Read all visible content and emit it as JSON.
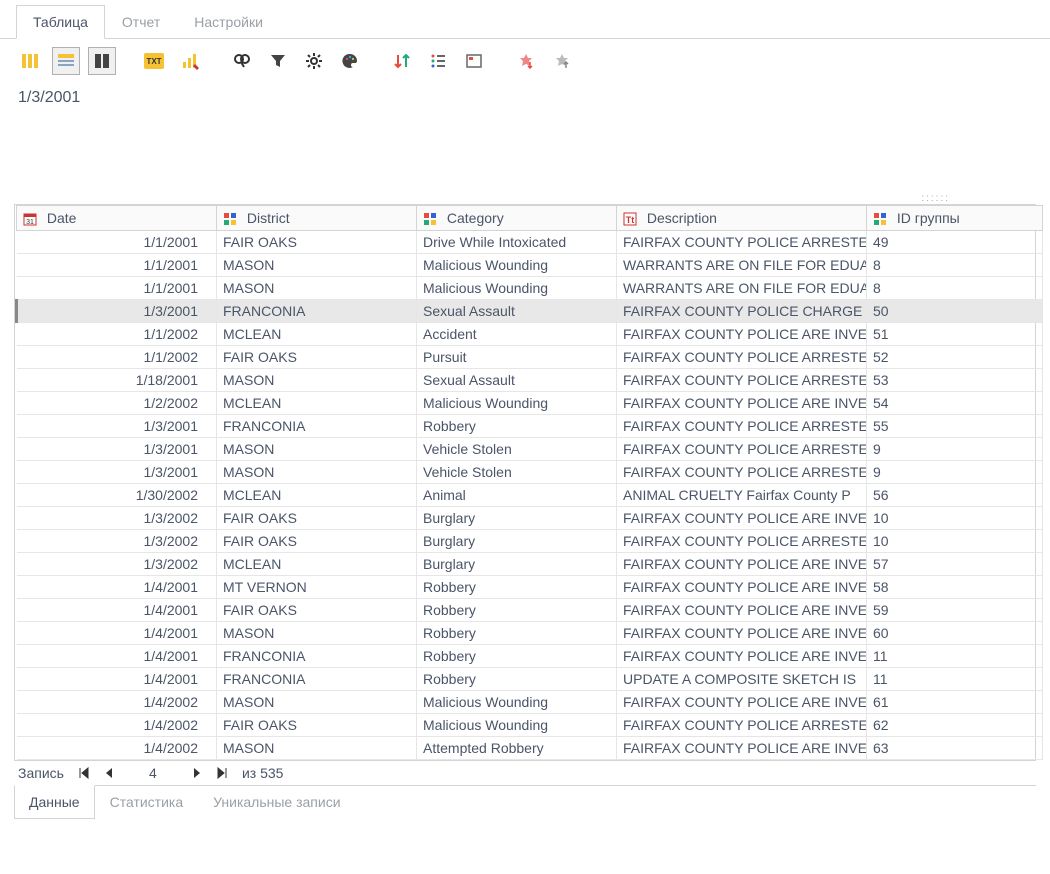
{
  "topTabs": {
    "items": [
      {
        "label": "Таблица",
        "active": true
      },
      {
        "label": "Отчет",
        "active": false
      },
      {
        "label": "Настройки",
        "active": false
      }
    ]
  },
  "detail": {
    "text": "1/3/2001"
  },
  "columns": {
    "date": "Date",
    "district": "District",
    "category": "Category",
    "description": "Description",
    "group": "ID группы"
  },
  "rows": [
    {
      "date": "1/1/2001",
      "district": "FAIR OAKS",
      "category": "Drive While Intoxicated",
      "description": "FAIRFAX COUNTY POLICE ARRESTE",
      "group": "49"
    },
    {
      "date": "1/1/2001",
      "district": "MASON",
      "category": "Malicious Wounding",
      "description": "WARRANTS ARE ON FILE FOR EDUA",
      "group": "8"
    },
    {
      "date": "1/1/2001",
      "district": "MASON",
      "category": "Malicious Wounding",
      "description": "WARRANTS ARE ON FILE FOR EDUA",
      "group": "8"
    },
    {
      "date": "1/3/2001",
      "district": "FRANCONIA",
      "category": "Sexual Assault",
      "description": "FAIRFAX COUNTY POLICE CHARGE",
      "group": "50",
      "selected": true
    },
    {
      "date": "1/1/2002",
      "district": "MCLEAN",
      "category": "Accident",
      "description": "FAIRFAX COUNTY POLICE ARE INVE",
      "group": "51"
    },
    {
      "date": "1/1/2002",
      "district": "FAIR OAKS",
      "category": "Pursuit",
      "description": "FAIRFAX COUNTY POLICE ARRESTE",
      "group": "52"
    },
    {
      "date": "1/18/2001",
      "district": "MASON",
      "category": "Sexual Assault",
      "description": "FAIRFAX COUNTY POLICE ARRESTE",
      "group": "53"
    },
    {
      "date": "1/2/2002",
      "district": "MCLEAN",
      "category": "Malicious Wounding",
      "description": "FAIRFAX COUNTY POLICE ARE INVE",
      "group": "54"
    },
    {
      "date": "1/3/2001",
      "district": "FRANCONIA",
      "category": "Robbery",
      "description": "FAIRFAX COUNTY POLICE ARRESTE",
      "group": "55"
    },
    {
      "date": "1/3/2001",
      "district": "MASON",
      "category": "Vehicle Stolen",
      "description": "FAIRFAX COUNTY POLICE ARRESTE",
      "group": "9"
    },
    {
      "date": "1/3/2001",
      "district": "MASON",
      "category": "Vehicle Stolen",
      "description": "FAIRFAX COUNTY POLICE ARRESTE",
      "group": "9"
    },
    {
      "date": "1/30/2002",
      "district": "MCLEAN",
      "category": "Animal",
      "description": "ANIMAL CRUELTY Fairfax County P",
      "group": "56"
    },
    {
      "date": "1/3/2002",
      "district": "FAIR OAKS",
      "category": "Burglary",
      "description": "FAIRFAX COUNTY POLICE ARE INVE",
      "group": "10"
    },
    {
      "date": "1/3/2002",
      "district": "FAIR OAKS",
      "category": "Burglary",
      "description": "FAIRFAX COUNTY POLICE ARRESTE",
      "group": "10"
    },
    {
      "date": "1/3/2002",
      "district": "MCLEAN",
      "category": "Burglary",
      "description": "FAIRFAX COUNTY POLICE ARE INVE",
      "group": "57"
    },
    {
      "date": "1/4/2001",
      "district": "MT VERNON",
      "category": "Robbery",
      "description": "FAIRFAX COUNTY POLICE ARE INVE",
      "group": "58"
    },
    {
      "date": "1/4/2001",
      "district": "FAIR OAKS",
      "category": "Robbery",
      "description": "FAIRFAX COUNTY POLICE ARE INVE",
      "group": "59"
    },
    {
      "date": "1/4/2001",
      "district": "MASON",
      "category": "Robbery",
      "description": "FAIRFAX COUNTY POLICE ARE INVE",
      "group": "60"
    },
    {
      "date": "1/4/2001",
      "district": "FRANCONIA",
      "category": "Robbery",
      "description": "FAIRFAX COUNTY POLICE ARE INVE",
      "group": "11"
    },
    {
      "date": "1/4/2001",
      "district": "FRANCONIA",
      "category": "Robbery",
      "description": "UPDATE A COMPOSITE SKETCH IS",
      "group": "11"
    },
    {
      "date": "1/4/2002",
      "district": "MASON",
      "category": "Malicious Wounding",
      "description": "FAIRFAX COUNTY POLICE ARE INVE",
      "group": "61"
    },
    {
      "date": "1/4/2002",
      "district": "FAIR OAKS",
      "category": "Malicious Wounding",
      "description": "FAIRFAX COUNTY POLICE ARRESTE",
      "group": "62"
    },
    {
      "date": "1/4/2002",
      "district": "MASON",
      "category": "Attempted Robbery",
      "description": "FAIRFAX COUNTY POLICE ARE INVE",
      "group": "63"
    }
  ],
  "paginator": {
    "label": "Запись",
    "current": "4",
    "totalLabel": "из 535"
  },
  "bottomTabs": {
    "items": [
      {
        "label": "Данные",
        "active": true
      },
      {
        "label": "Статистика",
        "active": false
      },
      {
        "label": "Уникальные записи",
        "active": false
      }
    ]
  }
}
